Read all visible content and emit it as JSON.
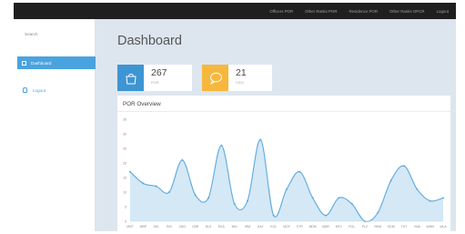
{
  "topnav": [
    "Officers POR",
    "Other Ranks POR",
    "Residence POR",
    "Other Ranks OPCR",
    "Logout"
  ],
  "sidebar": {
    "search_label": "Search",
    "items": [
      {
        "label": "Dashboard"
      },
      {
        "label": "Logout"
      }
    ]
  },
  "main": {
    "title": "Dashboard",
    "cards": [
      {
        "value": "267",
        "label": "POR",
        "icon": "shopping-bag-icon",
        "color": "#3e95d3"
      },
      {
        "value": "21",
        "label": "CRO",
        "icon": "speech-bubble-icon",
        "color": "#f6b73c"
      }
    ],
    "panel_title": "POR Overview"
  },
  "chart_data": {
    "type": "area",
    "categories": [
      "MVP",
      "MBP",
      "SEL",
      "BSI",
      "CBO",
      "CBR",
      "DLS",
      "EKA",
      "MIV",
      "IRM",
      "KAY",
      "KGL",
      "MCE",
      "KTR",
      "MDM",
      "MDR",
      "MTV",
      "POL",
      "PLZ",
      "RKM",
      "SGM",
      "TKT",
      "VNA",
      "WMN",
      "WLA"
    ],
    "values": [
      17,
      13,
      12,
      10,
      21,
      9,
      8,
      26,
      6,
      7,
      28,
      2,
      11,
      17,
      8,
      2,
      8,
      6,
      0,
      3,
      14,
      19,
      11,
      7,
      8
    ],
    "ylim": [
      0,
      35
    ],
    "yticks": [
      0,
      5,
      10,
      15,
      20,
      25,
      30,
      35
    ],
    "line_color": "#5ea9dd",
    "fill_color": "#d4e8f6"
  }
}
